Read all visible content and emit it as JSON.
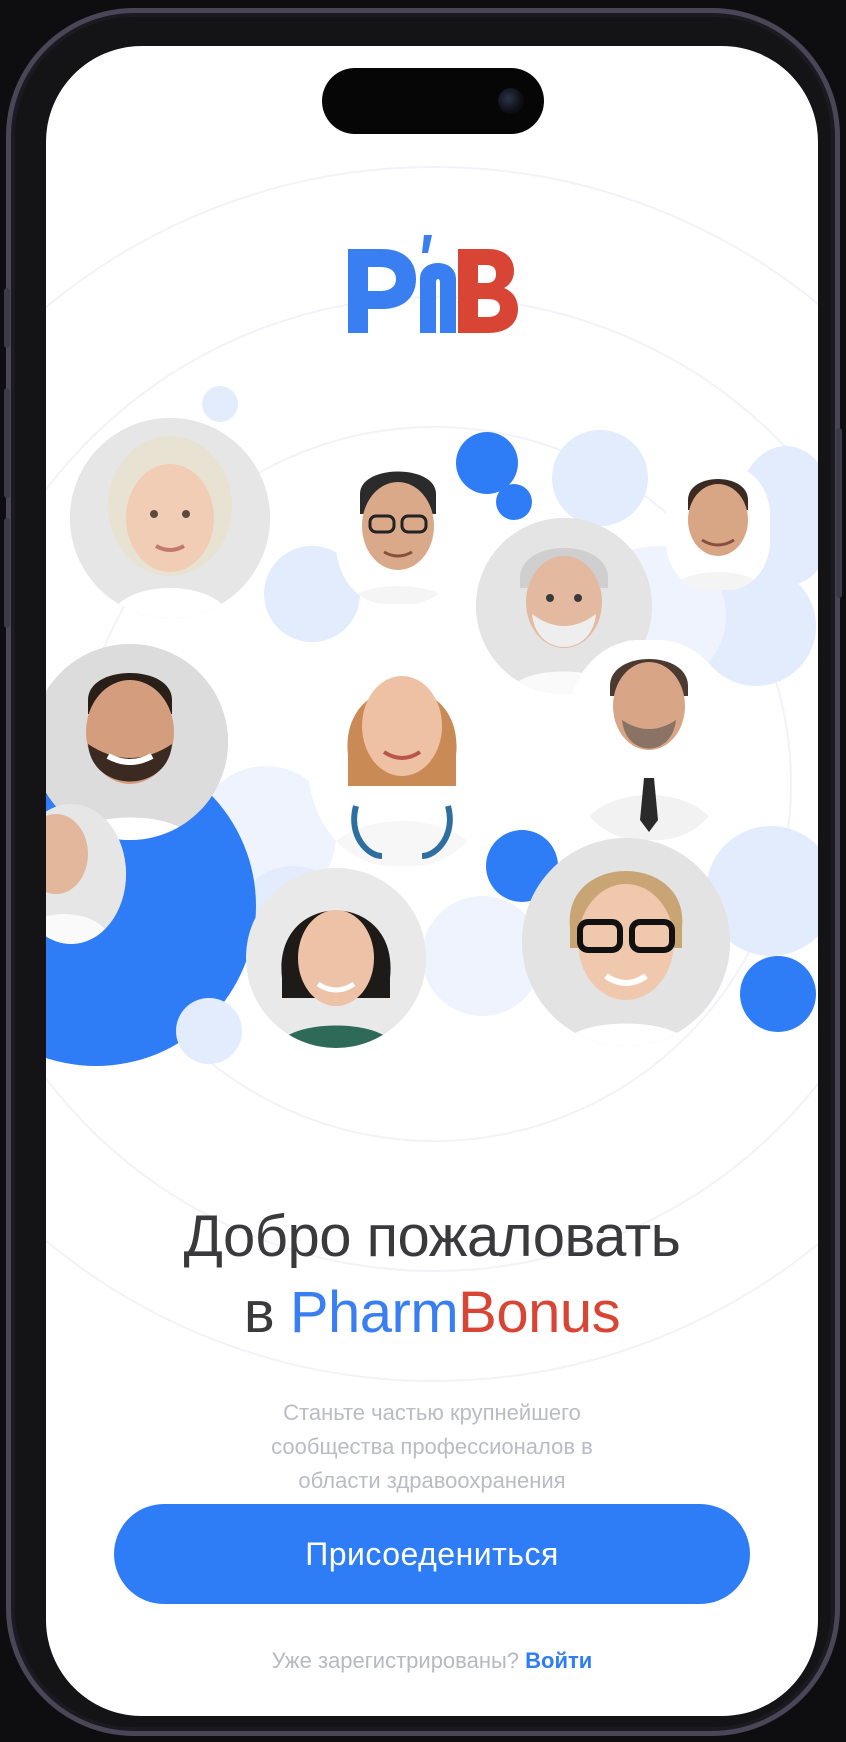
{
  "logo": {
    "text_left": "Ph",
    "text_right": "B"
  },
  "welcome": {
    "line1": "Добро пожаловать",
    "prefix": "в",
    "brand_part1": "Pharm",
    "brand_part2": "Bonus"
  },
  "subtitle": {
    "line1": "Станьте частью крупнейшего",
    "line2": "сообщества профессионалов в",
    "line3": "области здравоохранения"
  },
  "join_button": {
    "label": "Присоедениться"
  },
  "login": {
    "prompt": "Уже зарегистрированы?",
    "link": "Войти"
  },
  "colors": {
    "accent_blue": "#2f7df6",
    "brand_red": "#d94535",
    "bubble_light": "#e3ecfc"
  }
}
